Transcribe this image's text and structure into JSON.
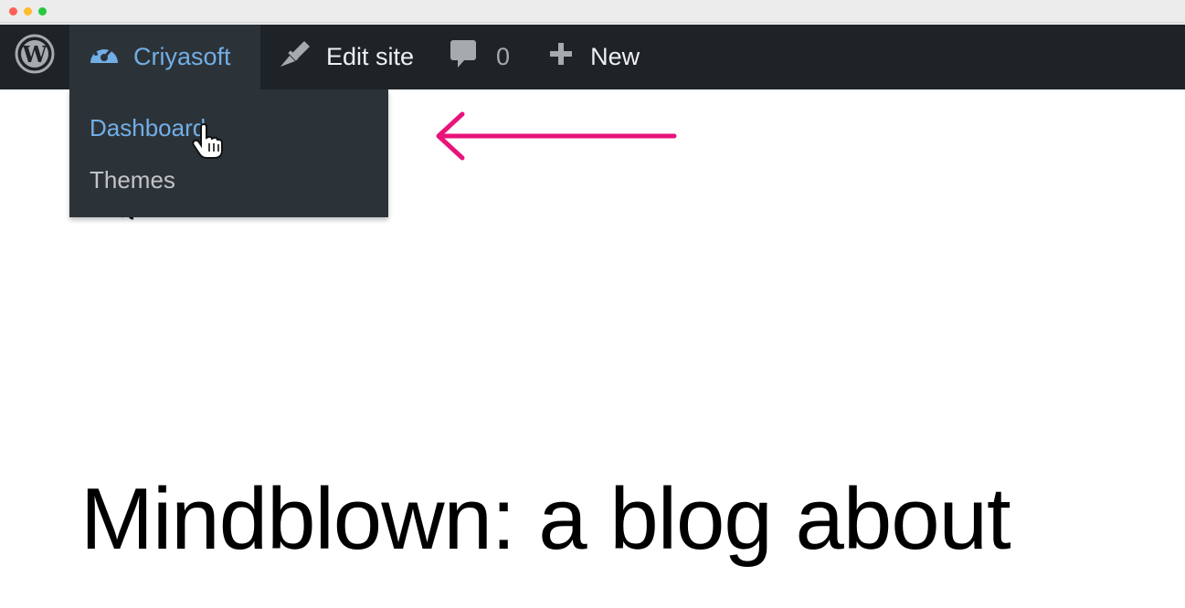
{
  "browser": {
    "window_buttons": [
      "close",
      "minimize",
      "maximize"
    ]
  },
  "admin_bar": {
    "logo_icon": "wordpress-logo-icon",
    "site_name": "Criyasoft",
    "site_icon": "dashboard-gauge-icon",
    "edit_site_label": "Edit site",
    "edit_site_icon": "paintbrush-icon",
    "comments_count": "0",
    "comments_icon": "comment-bubble-icon",
    "new_label": "New",
    "new_icon": "plus-icon"
  },
  "site_menu": {
    "items": [
      {
        "label": "Dashboard"
      },
      {
        "label": "Themes"
      }
    ]
  },
  "page": {
    "heading": "Mindblown: a blog about"
  },
  "annotation": {
    "arrow_icon": "left-arrow-icon",
    "arrow_color": "#e8137b"
  },
  "colors": {
    "admin_bar_bg": "#1d2327",
    "submenu_bg": "#2c3338",
    "link_blue": "#72aee6"
  }
}
